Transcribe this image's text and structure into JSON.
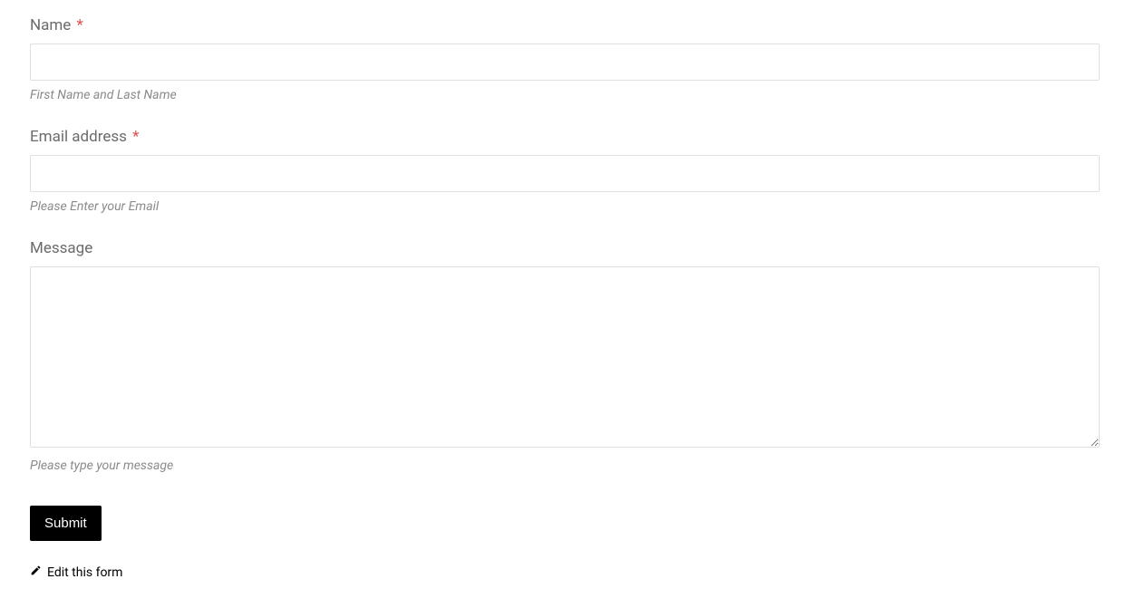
{
  "form": {
    "fields": {
      "name": {
        "label": "Name",
        "required_mark": "*",
        "help": "First Name and Last Name",
        "value": ""
      },
      "email": {
        "label": "Email address",
        "required_mark": "*",
        "help": "Please Enter your Email",
        "value": ""
      },
      "message": {
        "label": "Message",
        "help": "Please type your message",
        "value": ""
      }
    },
    "submit_label": "Submit",
    "edit_link_label": "Edit this form"
  }
}
